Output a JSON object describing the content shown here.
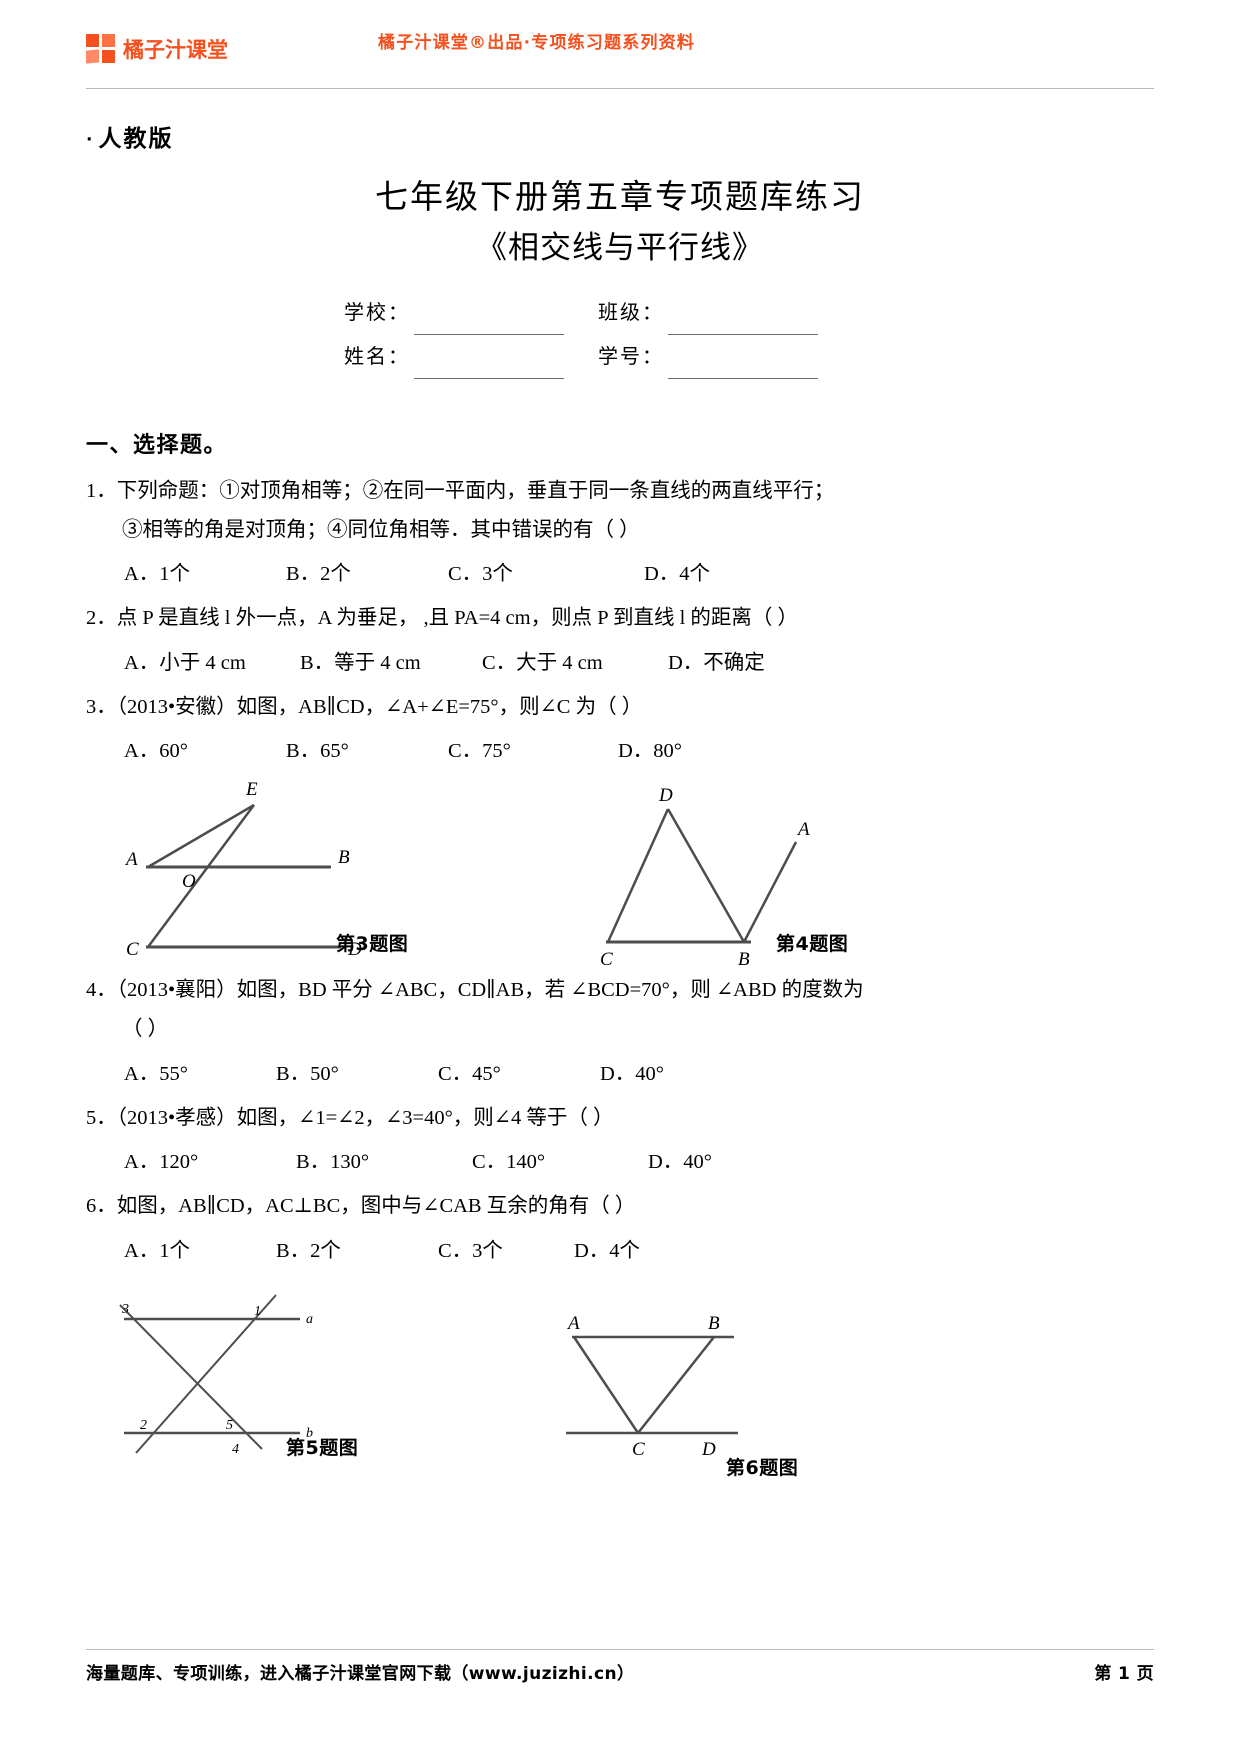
{
  "header": {
    "logo_text": "橘子汁课堂",
    "tagline": "橘子汁课堂®出品·专项练习题系列资料",
    "brand_color": "#F4511E"
  },
  "title_block": {
    "edition_bullet": "·",
    "edition": "人教版",
    "title": "七年级下册第五章专项题库练习",
    "subtitle": "《相交线与平行线》"
  },
  "info_fields": {
    "school_label": "学校：",
    "class_label": "班级：",
    "name_label": "姓名：",
    "student_id_label": "学号："
  },
  "section": {
    "heading": "一、选择题。"
  },
  "questions": [
    {
      "number": "1．",
      "line1": "下列命题：①对顶角相等；②在同一平面内，垂直于同一条直线的两直线平行；",
      "line2": "③相等的角是对顶角；④同位角相等．其中错误的有（      ）",
      "options": [
        "A．1个",
        "B．2个",
        "C．3个",
        "D．4个"
      ]
    },
    {
      "number": "2．",
      "line1": "点 P 是直线 l 外一点，A 为垂足，  ,且 PA=4 cm，则点 P 到直线 l 的距离（      ）",
      "options": [
        "A．小于 4 cm",
        "B．等于 4 cm",
        "C．大于 4 cm",
        "D．不确定"
      ]
    },
    {
      "number": "3．",
      "line1": "（2013•安徽）如图，AB∥CD，∠A+∠E=75°，则∠C 为（      ）",
      "options": [
        "A．60°",
        "B．65°",
        "C．75°",
        "D．80°"
      ]
    },
    {
      "number": "4．",
      "line1": "（2013•襄阳）如图，BD 平分 ∠ABC，CD∥AB，若 ∠BCD=70°，则 ∠ABD 的度数为",
      "line2": "（      ）",
      "options": [
        "A．55°",
        "B．50°",
        "C．45°",
        "D．40°"
      ]
    },
    {
      "number": "5．",
      "line1": "（2013•孝感）如图，∠1=∠2，∠3=40°，则∠4 等于（      ）",
      "options": [
        "A．120°",
        "B．130°",
        "C．140°",
        "D．40°"
      ]
    },
    {
      "number": "6．",
      "line1": "如图，AB∥CD，AC⊥BC，图中与∠CAB 互余的角有（      ）",
      "options": [
        "A．1个",
        "B．2个",
        "C．3个",
        "D．4个"
      ]
    }
  ],
  "figures": {
    "fig3_caption": "第3题图",
    "fig4_caption": "第4题图",
    "fig5_caption": "第5题图",
    "fig6_caption": "第6题图",
    "fig3_labels": [
      "E",
      "A",
      "B",
      "O",
      "C",
      "D"
    ],
    "fig4_labels": [
      "D",
      "A",
      "C",
      "B"
    ],
    "fig5_labels": [
      "3",
      "1",
      "a",
      "2",
      "5",
      "b",
      "4"
    ],
    "fig6_labels": [
      "A",
      "B",
      "C",
      "D"
    ]
  },
  "footer": {
    "note": "海量题库、专项训练，进入橘子汁课堂官网下载（www.juzizhi.cn）",
    "page": "第 1 页"
  }
}
